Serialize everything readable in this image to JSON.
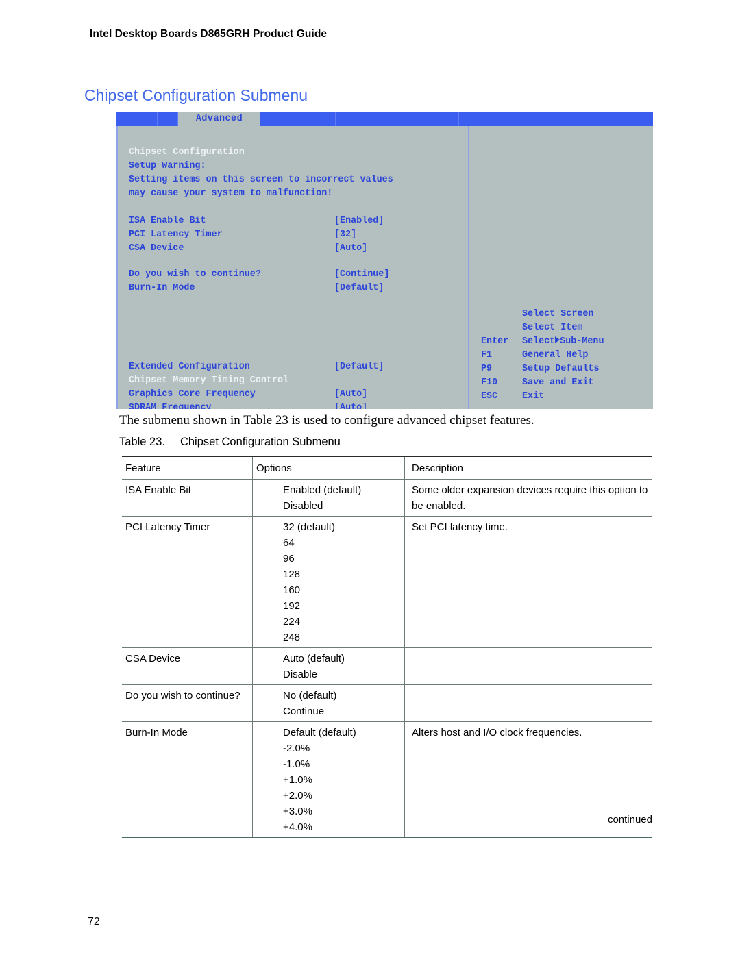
{
  "page": {
    "running_header": "Intel Desktop Boards D865GRH Product Guide",
    "number": "72",
    "continued_note": "continued"
  },
  "section": {
    "heading": "Chipset Configuration Submenu"
  },
  "bios_screen": {
    "active_tab": "Advanced",
    "screen_title": "Chipset Configuration",
    "warning_label": "Setup Warning:",
    "warning_line1": "Setting items on this screen to incorrect values",
    "warning_line2": "may cause your system to malfunction!",
    "settings": [
      {
        "label": "ISA Enable Bit",
        "value": "[Enabled]"
      },
      {
        "label": "PCI Latency Timer",
        "value": "[32]"
      },
      {
        "label": "CSA Device",
        "value": "[Auto]"
      },
      {
        "label": "Do you wish to continue?",
        "value": "[Continue]"
      },
      {
        "label": "Burn-In Mode",
        "value": "[Default]"
      },
      {
        "label": "Extended Configuration",
        "value": "[Default]"
      },
      {
        "label": "Chipset Memory Timing Control",
        "value": ""
      },
      {
        "label": "Graphics Core Frequency",
        "value": "[Auto]"
      },
      {
        "label": "SDRAM Frequency",
        "value": "[Auto]"
      }
    ],
    "help_keys": [
      {
        "key": "",
        "action": "Select Screen"
      },
      {
        "key": "",
        "action": "Select Item"
      },
      {
        "key": "Enter",
        "action_before": "Select",
        "action_after": "Sub-Menu",
        "has_arrow": true
      },
      {
        "key": "F1",
        "action": "General Help"
      },
      {
        "key": "P9",
        "action": "Setup Defaults"
      },
      {
        "key": "F10",
        "action": "Save and Exit"
      },
      {
        "key": "ESC",
        "action": "Exit"
      }
    ],
    "colors": {
      "menubar": "#3b5ef0",
      "background": "#b4c0c0",
      "text": "#2b44d8",
      "heading_text": "#eef2f2",
      "divider": "#8fa4e8"
    }
  },
  "body_paragraph": "The submenu shown in Table 23 is used to configure advanced chipset features.",
  "table": {
    "caption_number": "Table 23.",
    "caption_title": "Chipset Configuration Submenu",
    "headers": [
      "Feature",
      "Options",
      "Description"
    ],
    "rows": [
      {
        "feature": "ISA Enable Bit",
        "options": [
          "Enabled (default)",
          "Disabled"
        ],
        "description": "Some older expansion devices require this option to be enabled."
      },
      {
        "feature": "PCI Latency Timer",
        "options": [
          "32 (default)",
          "64",
          "96",
          "128",
          "160",
          "192",
          "224",
          "248"
        ],
        "description": "Set PCI latency time."
      },
      {
        "feature": "CSA Device",
        "options": [
          "Auto (default)",
          "Disable"
        ],
        "description": ""
      },
      {
        "feature": "Do you wish to continue?",
        "options": [
          "No (default)",
          "Continue"
        ],
        "description": ""
      },
      {
        "feature": "Burn-In Mode",
        "options": [
          "Default (default)",
          "-2.0%",
          "-1.0%",
          "+1.0%",
          "+2.0%",
          "+3.0%",
          "+4.0%"
        ],
        "description": "Alters host and I/O clock frequencies."
      }
    ]
  }
}
